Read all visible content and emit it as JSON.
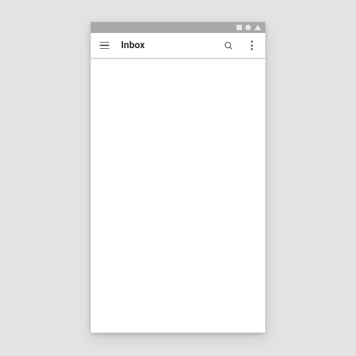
{
  "appBar": {
    "title": "Inbox"
  }
}
